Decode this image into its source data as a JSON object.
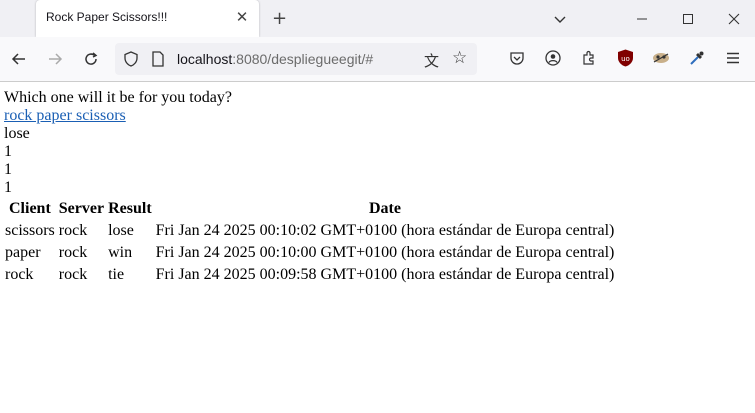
{
  "browser": {
    "tab_title": "Rock Paper Scissors!!!",
    "url_host": "localhost",
    "url_rest": ":8080/despliegueegit/#"
  },
  "page": {
    "prompt": "Which one will it be for you today?",
    "link_text": "rock paper scissors",
    "result": "lose",
    "counts": [
      "1",
      "1",
      "1"
    ],
    "table": {
      "headers": [
        "Client",
        "Server",
        "Result",
        "Date"
      ],
      "rows": [
        [
          "scissors",
          "rock",
          "lose",
          "Fri Jan 24 2025 00:10:02 GMT+0100 (hora estándar de Europa central)"
        ],
        [
          "paper",
          "rock",
          "win",
          "Fri Jan 24 2025 00:10:00 GMT+0100 (hora estándar de Europa central)"
        ],
        [
          "rock",
          "rock",
          "tie",
          "Fri Jan 24 2025 00:09:58 GMT+0100 (hora estándar de Europa central)"
        ]
      ]
    }
  }
}
